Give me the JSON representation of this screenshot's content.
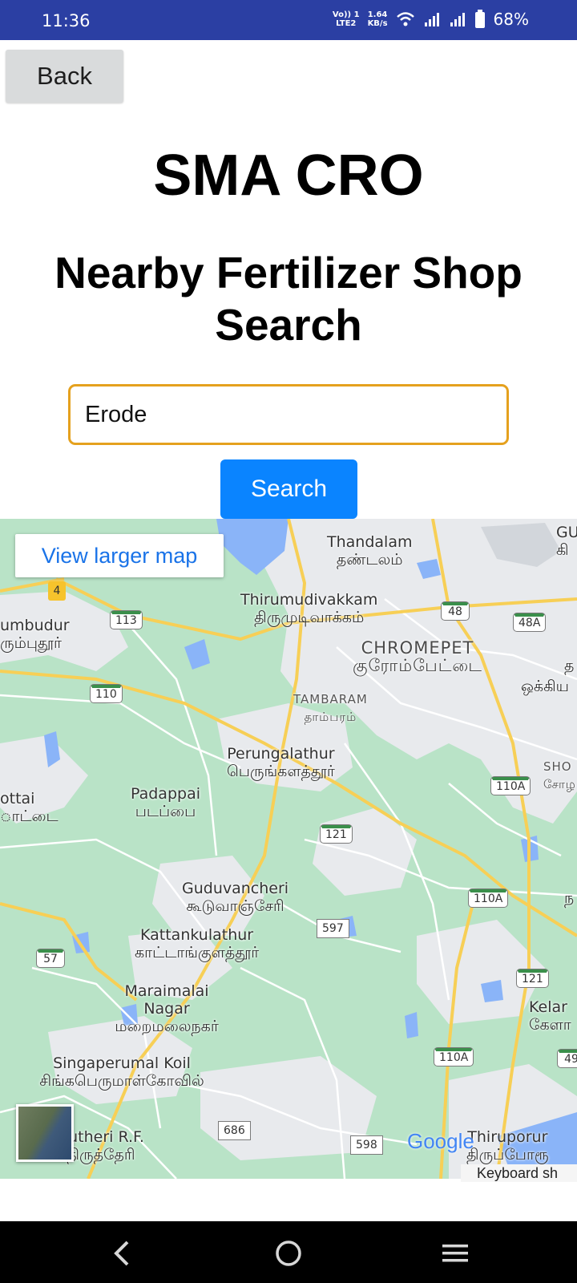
{
  "status_bar": {
    "time": "11:36",
    "network_label_top": "Vo)) 1",
    "network_label_bottom": "LTE2",
    "speed_value": "1.64",
    "speed_unit": "KB/s",
    "battery_percent": "68%"
  },
  "header": {
    "back_label": "Back",
    "app_title": "SMA CRO",
    "page_title": "Nearby Fertilizer Shop Search"
  },
  "search": {
    "value": "Erode",
    "placeholder": "",
    "button_label": "Search"
  },
  "map": {
    "view_larger_label": "View larger map",
    "provider_logo": "Google",
    "keyboard_shortcuts_label": "Keyboard sh",
    "colors": {
      "land": "#b9e3c7",
      "urban": "#e8eaed",
      "water": "#8ab4f8",
      "highway": "#f7cf56",
      "road": "#ffffff"
    },
    "places": [
      {
        "en": "Thandalam",
        "ta": "தண்டலம்"
      },
      {
        "en": "Thirumudivakkam",
        "ta": "திருமுடிவாக்கம்"
      },
      {
        "en": "CHROMEPET",
        "ta": "குரோம்பேட்டை"
      },
      {
        "en": "TAMBARAM",
        "ta": "தாம்பரம்"
      },
      {
        "en": "Perungalathur",
        "ta": "பெருங்களத்தூர்"
      },
      {
        "en": "Padappai",
        "ta": "படப்பை"
      },
      {
        "en": "Guduvancheri",
        "ta": "கூடுவாஞ்சேரி"
      },
      {
        "en": "Kattankulathur",
        "ta": "காட்டாங்குளத்தூர்"
      },
      {
        "en": "Maraimalai Nagar",
        "ta": "மறைமலைநகர்"
      },
      {
        "en": "Singaperumal Koil",
        "ta": "சிங்கபெருமாள்கோவில்"
      },
      {
        "en": "Thiruporur",
        "ta": "திருப்போரூ"
      },
      {
        "en": "irutheri R.F.",
        "ta": "திருத்தேரி"
      },
      {
        "en": "umbudur",
        "ta": "ரும்புதூர்"
      },
      {
        "en": "ottai",
        "ta": "ாட்டை"
      },
      {
        "en": "Kelar",
        "ta": "கேளா"
      },
      {
        "en": "SHO",
        "ta": "சோழ"
      },
      {
        "en": "GU",
        "ta": "கி"
      },
      {
        "en": "",
        "ta": "ஒக்கிய"
      },
      {
        "en": "",
        "ta": "ந"
      },
      {
        "en": "",
        "ta": "த"
      }
    ],
    "shields": [
      "4",
      "113",
      "110",
      "48",
      "48A",
      "110A",
      "121",
      "110A",
      "597",
      "57",
      "121",
      "110A",
      "686",
      "598",
      "49"
    ]
  },
  "nav_bar": {
    "back_icon": "chevron-left-icon",
    "home_icon": "circle-home-icon",
    "recents_icon": "menu-lines-icon"
  }
}
